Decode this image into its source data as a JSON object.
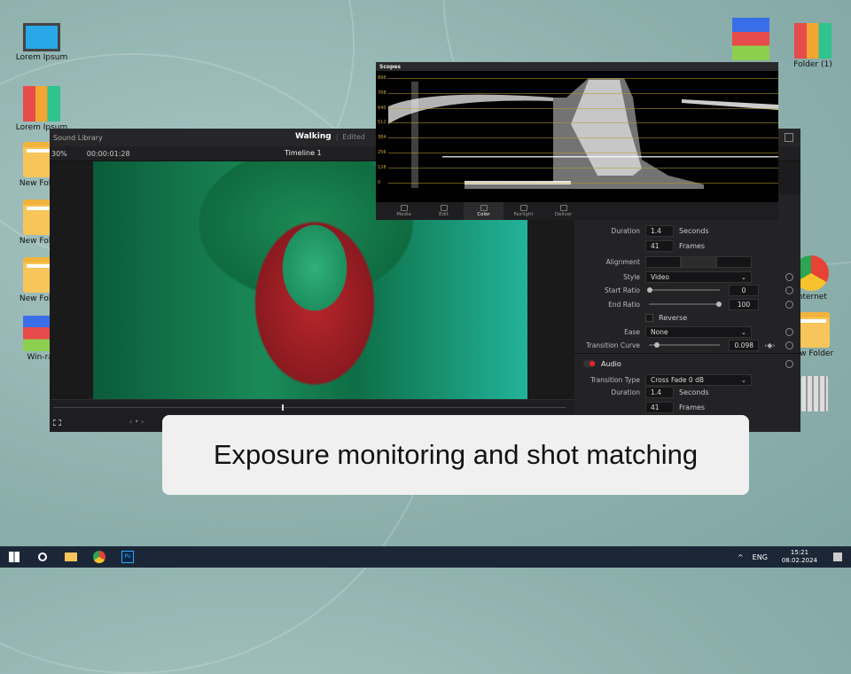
{
  "desktop": {
    "icons_left": [
      "Lorem Ipsum",
      "Lorem Ipsum",
      "New Folder",
      "New Folder",
      "New Folder",
      "Win-rar"
    ],
    "icons_right": [
      "Folder (1)",
      "Internet",
      "New Folder"
    ]
  },
  "resolve": {
    "sound_library": "Sound Library",
    "project": "Walking",
    "status": "Edited",
    "zoom": "30%",
    "timecode": "00:00:01:28",
    "timeline": "Timeline 1",
    "inspector": {
      "duration_label": "Duration",
      "duration_value": "1.4",
      "seconds": "Seconds",
      "frames_value": "41",
      "frames": "Frames",
      "alignment_label": "Alignment",
      "style_label": "Style",
      "style_value": "Video",
      "start_ratio_label": "Start Ratio",
      "start_ratio_value": "0",
      "start_ratio": 0,
      "end_ratio_label": "End Ratio",
      "end_ratio_value": "100",
      "end_ratio": 100,
      "reverse_label": "Reverse",
      "ease_label": "Ease",
      "ease_value": "None",
      "curve_label": "Transition Curve",
      "curve_value": "0.098",
      "curve": 0.098,
      "audio_label": "Audio",
      "transition_type_label": "Transition Type",
      "transition_type_value": "Cross Fade 0 dB",
      "audio_duration_label": "Duration",
      "audio_duration_value": "1.4",
      "audio_seconds": "Seconds",
      "audio_frames_value": "41",
      "audio_frames": "Frames"
    }
  },
  "scopes": {
    "title": "Scopes",
    "y_ticks": [
      "896",
      "768",
      "640",
      "512",
      "384",
      "256",
      "128",
      "0"
    ],
    "pages": [
      "Media",
      "Edit",
      "Color",
      "Fairlight",
      "Deliver"
    ],
    "active_page": "Color"
  },
  "caption": "Exposure monitoring and shot matching",
  "taskbar": {
    "lang": "ENG",
    "time": "15:21",
    "date": "08.02.2024"
  }
}
